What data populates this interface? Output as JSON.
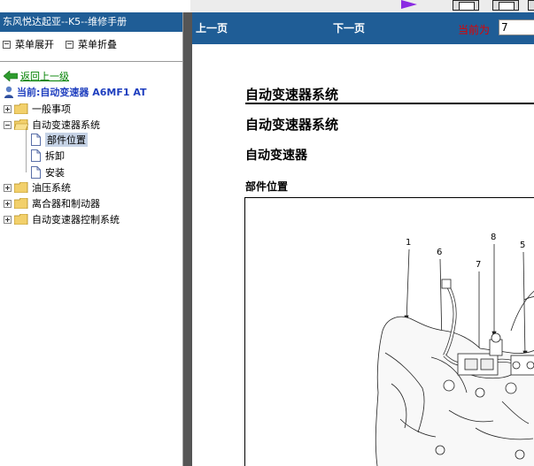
{
  "sidebar": {
    "title": "东风悦达起亚--K5--维修手册",
    "expand_label": "菜单展开",
    "collapse_label": "菜单折叠",
    "back_label": "返回上一级",
    "current_label": "当前:自动变速器 A6MF1 AT",
    "tree": [
      {
        "label": "一般事项",
        "type": "folder",
        "state": "collapsed"
      },
      {
        "label": "自动变速器系统",
        "type": "folder",
        "state": "expanded"
      },
      {
        "label": "部件位置",
        "type": "doc",
        "selected": true
      },
      {
        "label": "拆卸",
        "type": "doc"
      },
      {
        "label": "安装",
        "type": "doc"
      },
      {
        "label": "油压系统",
        "type": "folder",
        "state": "collapsed"
      },
      {
        "label": "离合器和制动器",
        "type": "folder",
        "state": "collapsed"
      },
      {
        "label": "自动变速器控制系统",
        "type": "folder",
        "state": "collapsed"
      }
    ]
  },
  "nav": {
    "prev_label": "上一页",
    "next_label": "下一页",
    "page_label": "当前为",
    "page_value": "7"
  },
  "content": {
    "section_heading": "自动变速器系统",
    "title": "自动变速器系统",
    "subtitle": "自动变速器",
    "subheading": "部件位置",
    "callouts": [
      "1",
      "6",
      "7",
      "8",
      "5"
    ]
  },
  "colors": {
    "header_blue": "#1f5d96",
    "page_label_red": "#e00000",
    "back_link_green": "#008000",
    "current_blue": "#1f3fbf",
    "selection": "#c6d3e6",
    "splitter": "#555555"
  }
}
